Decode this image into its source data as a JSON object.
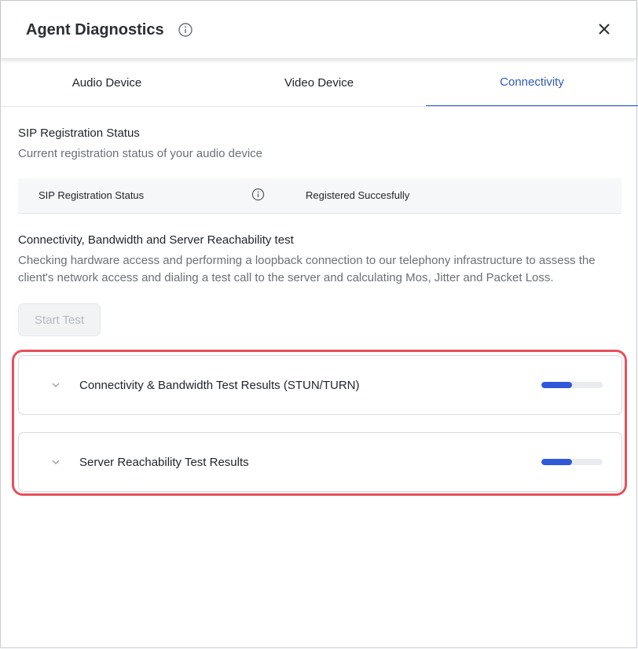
{
  "header": {
    "title": "Agent Diagnostics"
  },
  "tabs": [
    {
      "label": "Audio Device"
    },
    {
      "label": "Video Device"
    },
    {
      "label": "Connectivity"
    }
  ],
  "sip": {
    "title": "SIP Registration Status",
    "description": "Current registration status of your audio device",
    "row_label": "SIP Registration Status",
    "row_value": "Registered Succesfully"
  },
  "connectivity": {
    "title": "Connectivity, Bandwidth and Server Reachability test",
    "description": "Checking hardware access and performing a loopback connection to our telephony infrastructure to assess the client's network access and dialing a test call to the server and calculating Mos, Jitter and Packet Loss.",
    "start_label": "Start Test"
  },
  "results": [
    {
      "label": "Connectivity & Bandwidth Test Results (STUN/TURN)",
      "progress": 0.5
    },
    {
      "label": "Server Reachability Test Results",
      "progress": 0.5
    }
  ],
  "colors": {
    "accent": "#2e59b8",
    "progress": "#3158d8",
    "highlight": "#e8505b"
  }
}
